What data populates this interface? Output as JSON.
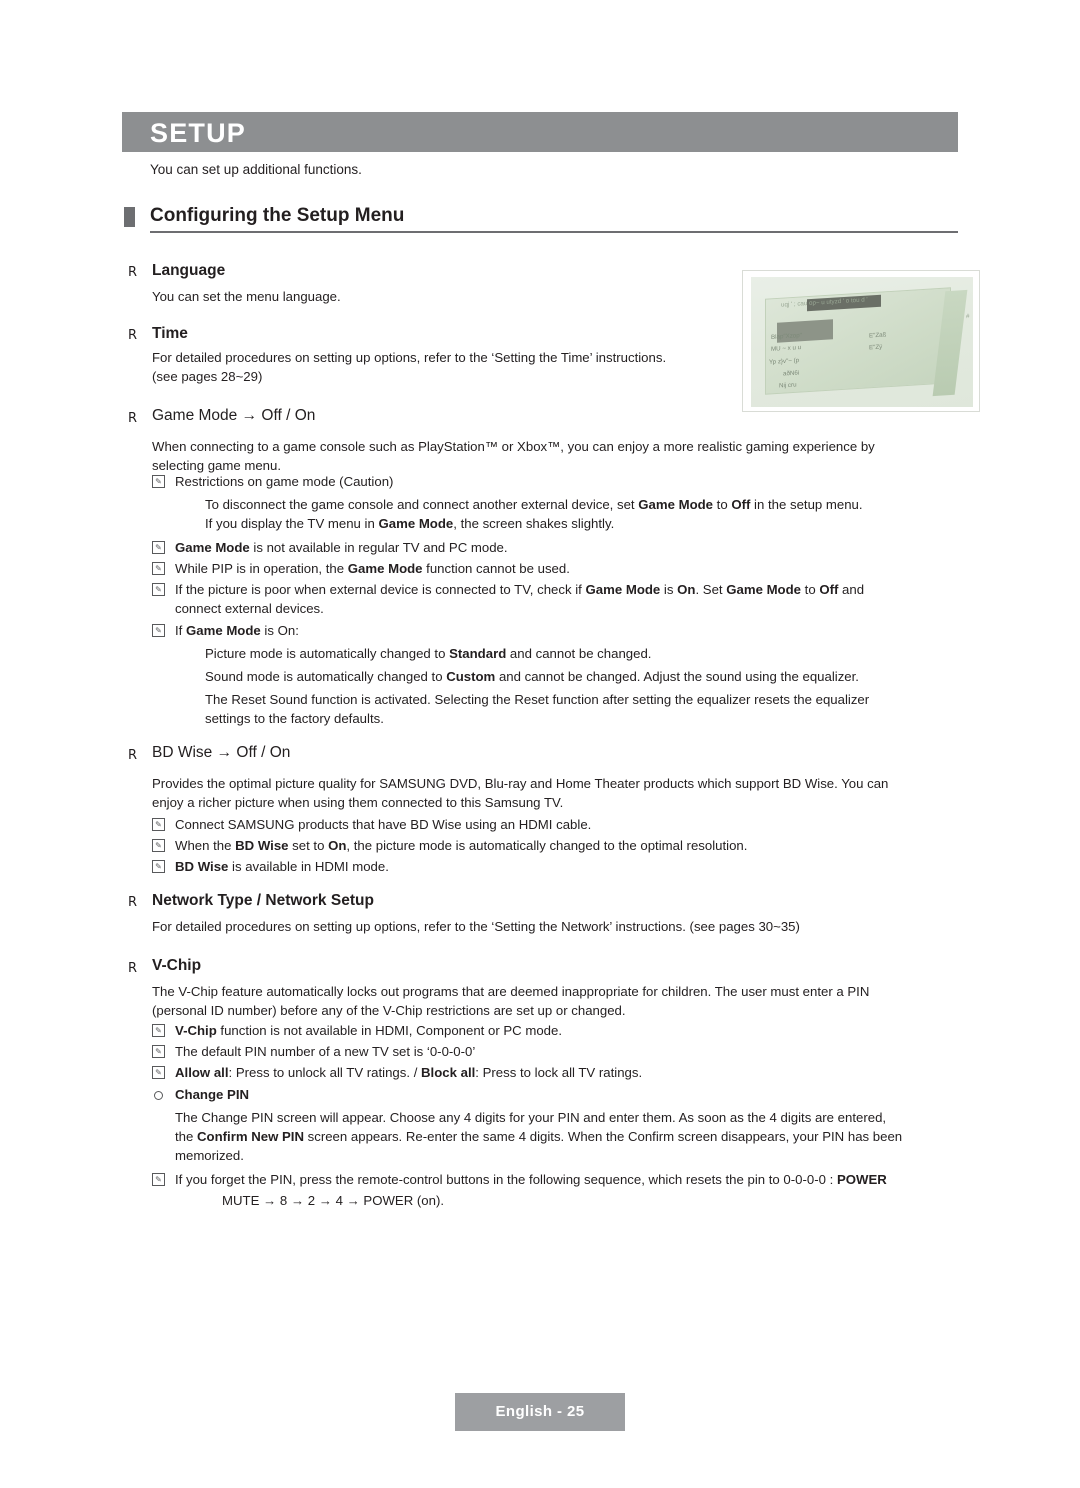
{
  "header": {
    "title": "SETUP",
    "subtitle": "You can set up additional functions.",
    "section_title": "Configuring the Setup Menu"
  },
  "items": {
    "language": {
      "heading": "Language",
      "body": "You can set the menu language."
    },
    "time": {
      "heading": "Time",
      "body_line1": "For detailed procedures on setting up options, refer to the ‘Setting the Time’ instructions.",
      "body_line2": "(see pages 28~29)"
    },
    "game_mode": {
      "heading": "Game Mode → Off / On",
      "body_line1": "When connecting to a game console such as PlayStation™ or Xbox™, you can enjoy a more realistic gaming experience by",
      "body_line2": "selecting game menu.",
      "note1": "Restrictions on game mode (Caution)",
      "note1_sub1_a": "To disconnect the game console and connect another external device, set ",
      "note1_sub1_b": "Game Mode",
      "note1_sub1_c": " to ",
      "note1_sub1_d": "Off",
      "note1_sub1_e": " in the setup menu.",
      "note1_sub2_a": "If you display the TV menu in ",
      "note1_sub2_b": "Game Mode",
      "note1_sub2_c": ", the screen shakes slightly.",
      "note2_a": "Game Mode",
      "note2_b": " is not available in regular TV and PC mode.",
      "note3_a": "While PIP is in operation, the ",
      "note3_b": "Game Mode",
      "note3_c": " function cannot be used.",
      "note4_a": "If the picture is poor when external device is connected to TV, check if ",
      "note4_b": "Game Mode",
      "note4_c": " is ",
      "note4_d": "On",
      "note4_e": ". Set ",
      "note4_f": "Game Mode",
      "note4_g": " to ",
      "note4_h": "Off",
      "note4_i": " and",
      "note4_j": "connect external devices.",
      "note5_a": "If ",
      "note5_b": "Game Mode",
      "note5_c": " is On:",
      "note5_sub1_a": "Picture mode is automatically changed to ",
      "note5_sub1_b": "Standard",
      "note5_sub1_c": " and cannot be changed.",
      "note5_sub2_a": "Sound mode is automatically changed to ",
      "note5_sub2_b": "Custom",
      "note5_sub2_c": " and cannot be changed. Adjust the sound using the equalizer.",
      "note5_sub3_line1": "The Reset Sound function is activated. Selecting the Reset function after setting the equalizer resets the equalizer",
      "note5_sub3_line2": "settings to the factory defaults."
    },
    "bd_wise": {
      "heading": "BD Wise → Off / On",
      "body_line1": "Provides the optimal picture quality for SAMSUNG DVD, Blu-ray and Home Theater products which support BD Wise. You can",
      "body_line2": "enjoy a richer picture when using them connected to this Samsung TV.",
      "note1": "Connect SAMSUNG products that have BD Wise using an HDMI cable.",
      "note2_a": "When the ",
      "note2_b": "BD Wise",
      "note2_c": " set to ",
      "note2_d": "On",
      "note2_e": ", the picture mode is automatically changed to the optimal resolution.",
      "note3_a": "BD Wise",
      "note3_b": " is available in HDMI mode."
    },
    "network": {
      "heading": "Network Type / Network Setup",
      "body": "For detailed procedures on setting up options, refer to the ‘Setting the Network’ instructions. (see pages 30~35)"
    },
    "vchip": {
      "heading": "V-Chip",
      "body_line1": "The V-Chip feature automatically locks out programs that are deemed inappropriate for children. The user must enter a PIN",
      "body_line2": "(personal ID number) before any of the V-Chip restrictions are set up or changed.",
      "note1_a": "V-Chip",
      "note1_b": " function is not available in HDMI, Component or PC mode.",
      "note2": "The default PIN number of a new TV set is ‘0-0-0-0’",
      "note3_a": "Allow all",
      "note3_b": ": Press to unlock all TV ratings. / ",
      "note3_c": "Block all",
      "note3_d": ": Press to lock all TV ratings.",
      "change_pin_heading": "Change PIN",
      "change_pin_line1": "The Change PIN screen will appear. Choose any 4 digits for your PIN and enter them. As soon as the 4 digits are entered,",
      "change_pin_line2_a": "the ",
      "change_pin_line2_b": "Confirm New PIN",
      "change_pin_line2_c": " screen appears. Re-enter the same 4 digits. When the Confirm screen disappears, your PIN has been",
      "change_pin_line3": "memorized.",
      "note4_a": "If you forget the PIN, press the remote-control buttons in the following sequence, which resets the pin to 0-0-0-0 : ",
      "note4_b": "POWER",
      "note4_c": "MUTE → 8 → 2 → 4 → POWER (on)."
    }
  },
  "screenshot": {
    "line1": "uqj ' ; cau op~ u   utyzd ' o tou d '",
    "line2": "Blap\"Xzop\"",
    "line3": "E\"Zaß",
    "line4": "MU ~ x u u",
    "line5": "E\"Zÿ",
    "line6": "Yp  z}v\"~ (p",
    "line7": "aðN6i",
    "line8": "Nij cru",
    "hash": "#"
  },
  "footer": {
    "label": "English - 25"
  }
}
